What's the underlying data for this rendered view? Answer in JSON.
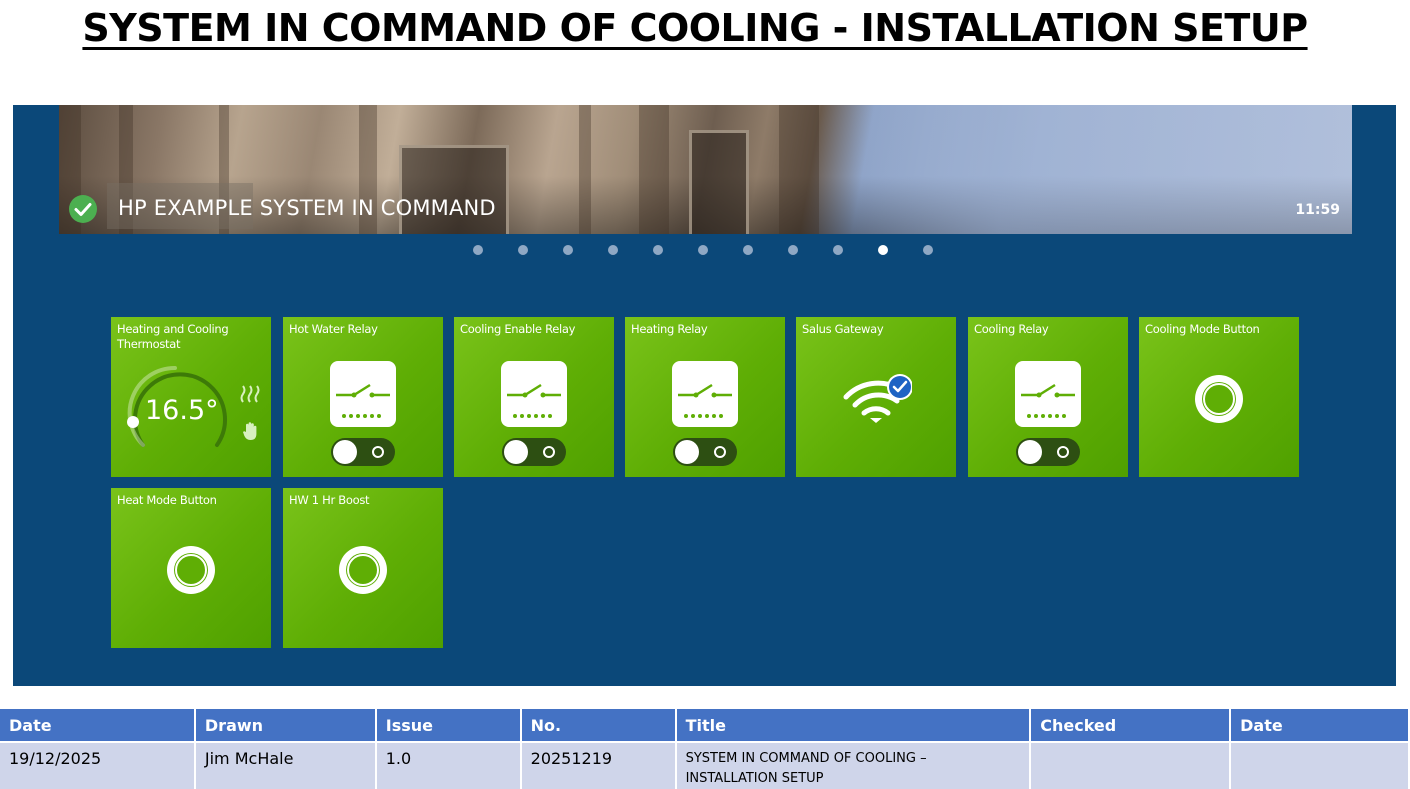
{
  "page": {
    "title": "SYSTEM IN COMMAND OF COOLING - INSTALLATION SETUP"
  },
  "banner": {
    "status_icon": "check-circle-icon",
    "title": "HP EXAMPLE SYSTEM IN COMMAND",
    "time": "11:59"
  },
  "pager": {
    "total": 11,
    "active_index": 9
  },
  "tiles": [
    {
      "label": "Heating and Cooling Thermostat",
      "kind": "thermostat",
      "temperature": "16.5°"
    },
    {
      "label": "Hot Water Relay",
      "kind": "relay",
      "state": "off"
    },
    {
      "label": "Cooling Enable Relay",
      "kind": "relay",
      "state": "off"
    },
    {
      "label": "Heating Relay",
      "kind": "relay",
      "state": "off"
    },
    {
      "label": "Salus Gateway",
      "kind": "gateway",
      "connected": true
    },
    {
      "label": "Cooling Relay",
      "kind": "relay",
      "state": "off"
    },
    {
      "label": "Cooling Mode Button",
      "kind": "button"
    },
    {
      "label": "Heat Mode Button",
      "kind": "button"
    },
    {
      "label": "HW 1 Hr Boost",
      "kind": "button"
    }
  ],
  "colors": {
    "panel": "#0b4879",
    "tile": "#66b30c",
    "header": "#4472c4",
    "row": "#cfd5ea"
  },
  "footer": {
    "headers": [
      "Date",
      "Drawn",
      "Issue",
      "No.",
      "Title",
      "Checked",
      "Date"
    ],
    "row": [
      "19/12/2025",
      "Jim McHale",
      "1.0",
      "20251219",
      "SYSTEM IN COMMAND OF COOLING – INSTALLATION SETUP",
      "",
      ""
    ]
  }
}
